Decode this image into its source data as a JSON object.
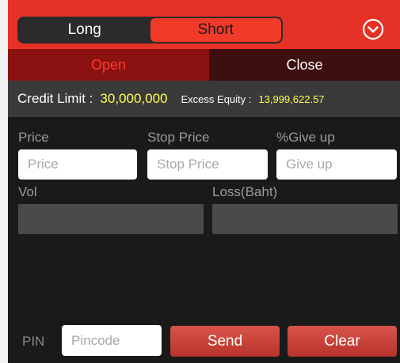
{
  "header": {
    "segment_long": "Long",
    "segment_short": "Short",
    "selected_segment": "Short",
    "menu_icon": "chevron-down-circle-icon"
  },
  "tabs": {
    "open": "Open",
    "close": "Close",
    "active": "Open"
  },
  "credit": {
    "credit_limit_label": "Credit Limit :",
    "credit_limit_value": "30,000,000",
    "excess_equity_label": "Excess Equity :",
    "excess_equity_value": "13,999,622.57"
  },
  "form": {
    "price_label": "Price",
    "price_placeholder": "Price",
    "stop_price_label": "Stop Price",
    "stop_price_placeholder": "Stop Price",
    "give_up_label": "%Give up",
    "give_up_placeholder": "Give up",
    "vol_label": "Vol",
    "loss_label": "Loss(Baht)"
  },
  "footer": {
    "pin_label": "PIN",
    "pin_placeholder": "Pincode",
    "send_label": "Send",
    "clear_label": "Clear"
  },
  "colors": {
    "header_red": "#e63126",
    "accent_yellow": "#ffff4d",
    "tab_open_text": "#ff3b2e"
  }
}
